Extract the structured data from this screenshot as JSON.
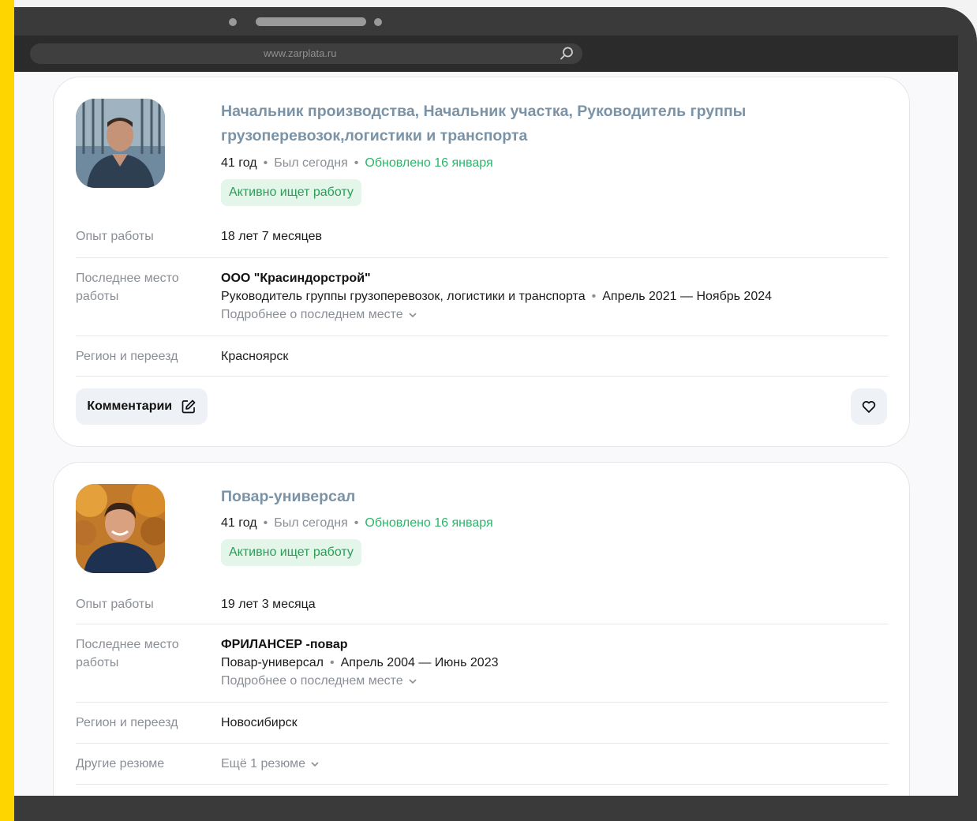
{
  "browser": {
    "url": "www.zarplata.ru"
  },
  "resumes": [
    {
      "title": "Начальник производства, Начальник участка, Руководитель группы грузоперевозок,логистики и транспорта",
      "age": "41 год",
      "last_seen": "Был сегодня",
      "updated": "Обновлено 16 января",
      "status_badge": "Активно ищет работу",
      "experience_label": "Опыт работы",
      "experience_value": "18 лет 7 месяцев",
      "last_job_label": "Последнее место работы",
      "last_job_company": "ООО \"Красиндорстрой\"",
      "last_job_position": "Руководитель группы грузоперевозок, логистики и транспорта",
      "last_job_period": "Апрель 2021 — Ноябрь 2024",
      "last_job_more": "Подробнее о последнем месте",
      "region_label": "Регион и переезд",
      "region_value": "Красноярск",
      "comments_label": "Комментарии"
    },
    {
      "title": "Повар-универсал",
      "age": "41 год",
      "last_seen": "Был сегодня",
      "updated": "Обновлено 16 января",
      "status_badge": "Активно ищет работу",
      "experience_label": "Опыт работы",
      "experience_value": "19 лет 3 месяца",
      "last_job_label": "Последнее место работы",
      "last_job_company": "ФРИЛАНСЕР -повар",
      "last_job_position": "Повар-универсал",
      "last_job_period": "Апрель 2004 — Июнь 2023",
      "last_job_more": "Подробнее о последнем месте",
      "region_label": "Регион и переезд",
      "region_value": "Новосибирск",
      "other_label": "Другие резюме",
      "other_value": "Ещё 1 резюме"
    }
  ],
  "colors": {
    "brand_yellow": "#ffd500",
    "title": "#7b93a6",
    "green": "#2eb36a",
    "badge_bg": "#e4f6ea"
  },
  "icons": [
    "search-icon",
    "edit-icon",
    "heart-icon",
    "chevron-down-icon"
  ]
}
